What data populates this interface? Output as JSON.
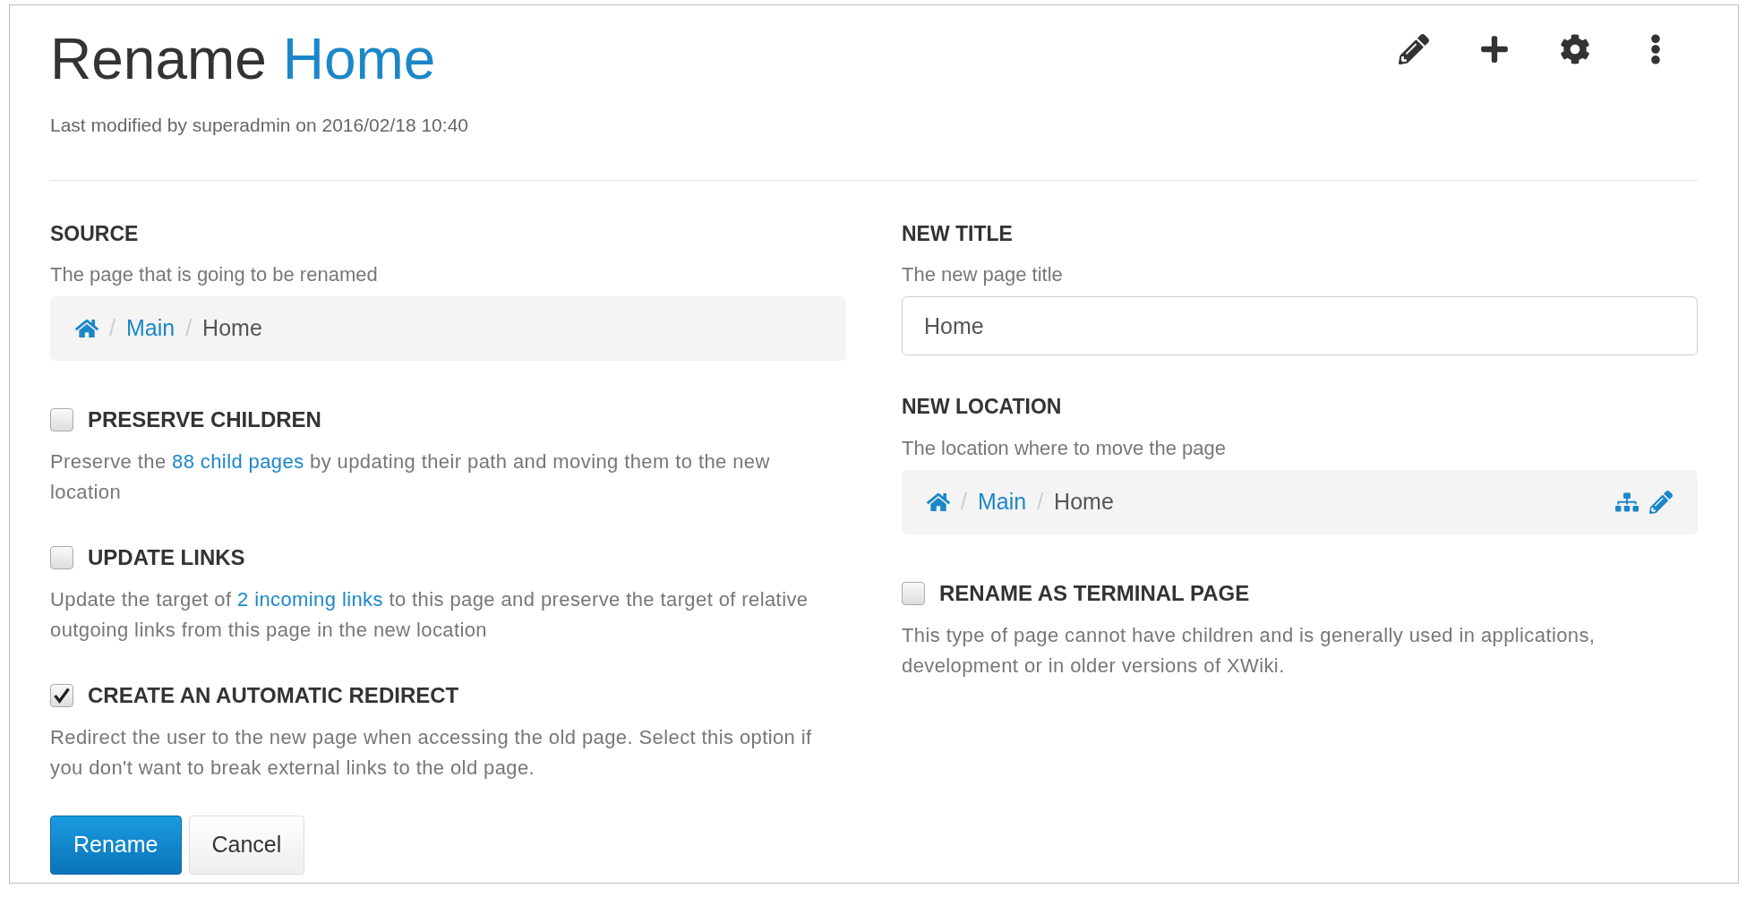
{
  "header": {
    "title_prefix": "Rename",
    "title_page": "Home",
    "meta": "Last modified by superadmin on 2016/02/18 10:40",
    "actions": [
      {
        "kind": "edit"
      },
      {
        "kind": "add"
      },
      {
        "kind": "settings"
      },
      {
        "kind": "more"
      }
    ]
  },
  "source": {
    "label": "SOURCE",
    "hint": "The page that is going to be renamed",
    "separator": "/",
    "breadcrumb": [
      {
        "text": "Main",
        "kind": "link"
      },
      {
        "text": "Home",
        "kind": "current"
      }
    ]
  },
  "options_left": [
    {
      "label": "PRESERVE CHILDREN",
      "checked": false,
      "description": [
        {
          "kind": "text",
          "text": "Preserve the "
        },
        {
          "kind": "link",
          "text": "88 child pages"
        },
        {
          "kind": "text",
          "text": " by updating their path and moving them to the new location"
        }
      ]
    },
    {
      "label": "UPDATE LINKS",
      "checked": false,
      "description": [
        {
          "kind": "text",
          "text": "Update the target of "
        },
        {
          "kind": "link",
          "text": "2 incoming links"
        },
        {
          "kind": "text",
          "text": " to this page and preserve the target of relative outgoing links from this page in the new location"
        }
      ]
    },
    {
      "label": "CREATE AN AUTOMATIC REDIRECT",
      "checked": true,
      "description": [
        {
          "kind": "text",
          "text": "Redirect the user to the new page when accessing the old page. Select this option if you don't want to break external links to the old page."
        }
      ]
    }
  ],
  "buttons": [
    {
      "label": "Rename",
      "kind": "primary"
    },
    {
      "label": "Cancel",
      "kind": "default"
    }
  ],
  "new_title": {
    "label": "NEW TITLE",
    "hint": "The new page title",
    "value": "Home"
  },
  "new_location": {
    "label": "NEW LOCATION",
    "hint": "The location where to move the page",
    "separator": "/",
    "breadcrumb": [
      {
        "text": "Main",
        "kind": "link"
      },
      {
        "text": "Home",
        "kind": "current"
      }
    ]
  },
  "options_right": [
    {
      "label": "RENAME AS TERMINAL PAGE",
      "checked": false,
      "description": [
        {
          "kind": "text",
          "text": "This type of page cannot have children and is generally used in applications, development or in older versions of XWiki."
        }
      ]
    }
  ]
}
